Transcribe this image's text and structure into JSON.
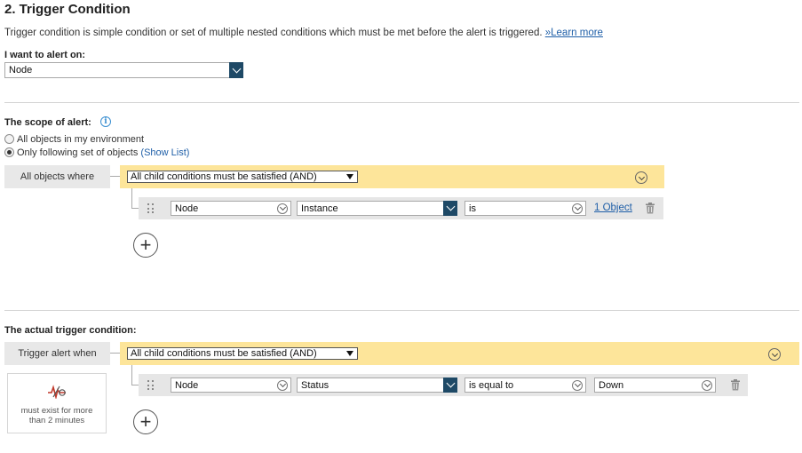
{
  "section": {
    "title": "2. Trigger Condition",
    "description": "Trigger condition is simple condition or set of multiple nested conditions which must be met before the alert is triggered.",
    "learn_more": "»Learn more"
  },
  "alert_on": {
    "label": "I want to alert on:",
    "value": "Node"
  },
  "scope": {
    "label": "The scope of alert:",
    "options": [
      {
        "label": "All objects in my environment",
        "selected": false
      },
      {
        "label": "Only following set of objects",
        "selected": true
      }
    ],
    "show_list": "(Show List)",
    "group_label": "All objects where",
    "group_operator": "All child conditions must be satisfied (AND)",
    "condition": {
      "object": "Node",
      "field": "Instance",
      "operator": "is",
      "value_link": "1 Object"
    }
  },
  "trigger": {
    "label": "The actual trigger condition:",
    "group_label": "Trigger alert when",
    "group_operator": "All child conditions must be satisfied (AND)",
    "condition": {
      "object": "Node",
      "field": "Status",
      "operator": "is equal to",
      "value": "Down"
    },
    "time_text": "must exist for more than 2 minutes"
  },
  "icons": {
    "info": "info-icon",
    "collapse": "chevron-down-circle-icon",
    "grip": "drag-handle-icon",
    "delete": "trash-icon",
    "add": "add-circle-icon",
    "time": "waveform-icon"
  },
  "colors": {
    "group_bar": "#fde59a",
    "dropdown_button": "#1e4966",
    "link": "#1f5fa8"
  }
}
